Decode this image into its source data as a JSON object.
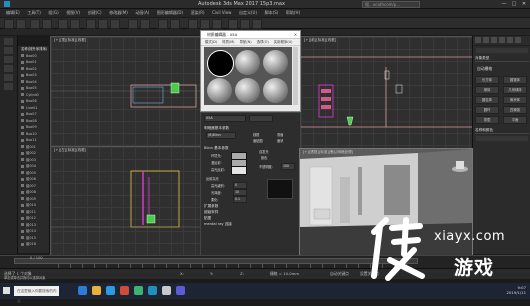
{
  "window": {
    "title": "Autodesk 3ds Max 2017    15p3.max",
    "search_placeholder": "搜...ocathcom/p...",
    "min": "—",
    "max": "□",
    "close": "✕"
  },
  "menubar": {
    "items": [
      "编辑(E)",
      "工具(T)",
      "组(G)",
      "视图(V)",
      "创建(C)",
      "修改器(M)",
      "动画(A)",
      "图形编辑器(D)",
      "渲染(R)",
      "Civil View",
      "自定义(U)",
      "脚本(S)",
      "帮助(H)"
    ]
  },
  "scene_explorer": {
    "header": "名称(按升序排序)",
    "rows": [
      "Box00",
      "Box01",
      "Box02",
      "Box03",
      "Box04",
      "Box05",
      "Cylind0",
      "Box06",
      "Line01",
      "Box07",
      "Box08",
      "Box09",
      "Box10",
      "Box11",
      "组001",
      "组002",
      "组003",
      "组004",
      "组005",
      "组006",
      "组007",
      "组008",
      "组009",
      "组010",
      "组011",
      "组012",
      "组013",
      "组014",
      "组015",
      "组016"
    ]
  },
  "viewports": {
    "top_left": "[+][顶][标准][线框]",
    "top_right": "[+][前][标准][线框]",
    "bottom_left": "[+][左][标准][线框]",
    "bottom_right": "[+][透视][标准][默认明暗处理]"
  },
  "material_editor": {
    "title": "材质编辑器 - 05A",
    "menus": [
      "模式(D)",
      "材质(M)",
      "导航(N)",
      "选项(O)",
      "实用程序(U)"
    ],
    "name_value": "05A",
    "sections": {
      "shader": "明暗器基本参数",
      "shader_type": "(B)Blinn",
      "wire": "线框",
      "two_sided": "双面",
      "face_map": "面贴图",
      "faceted": "面状",
      "blinn": "Blinn 基本参数",
      "self_illum": "自发光",
      "ambient": "环境光:",
      "diffuse": "漫反射:",
      "specular": "高光反射:",
      "color": "颜色",
      "opacity": "不透明度:",
      "opacity_value": "100",
      "spec_highlights": "反射高光",
      "spec_level": "高光级别:",
      "spec_level_value": "0",
      "gloss": "光泽度:",
      "gloss_value": "10",
      "soften": "柔化:",
      "soften_value": "0.1",
      "extended": "扩展参数",
      "supersampling": "超级采样",
      "maps": "贴图",
      "mental_ray": "mental ray 连接"
    }
  },
  "command_panel": {
    "title": "对象类型",
    "autogrid": "自动栅格",
    "buttons": [
      "长方体",
      "圆锥体",
      "球体",
      "几何球体",
      "圆柱体",
      "管状体",
      "圆环",
      "四棱锥",
      "茶壶",
      "平面"
    ],
    "name_color": "名称和颜色"
  },
  "timeline": {
    "frame": "0 / 100"
  },
  "statusbar": {
    "left": "选择了 1 个对象",
    "hint": "单击或单击并拖动以选择对象",
    "x": "X:",
    "y": "Y:",
    "z": "Z:",
    "grid": "栅格 = 10.0mm",
    "autokey": "自动关键点",
    "setkey": "设置关键点"
  },
  "taskbar": {
    "search": "在这里输入你要搜索的内容",
    "time": "9:07",
    "date": "2019/1/11"
  },
  "watermark": {
    "site": "xiayx.com",
    "name": "游戏"
  },
  "colors": {
    "accent": "#1f8fbf",
    "selection": "#e33ad8",
    "yellow": "#e8c840",
    "green": "#46d046"
  }
}
